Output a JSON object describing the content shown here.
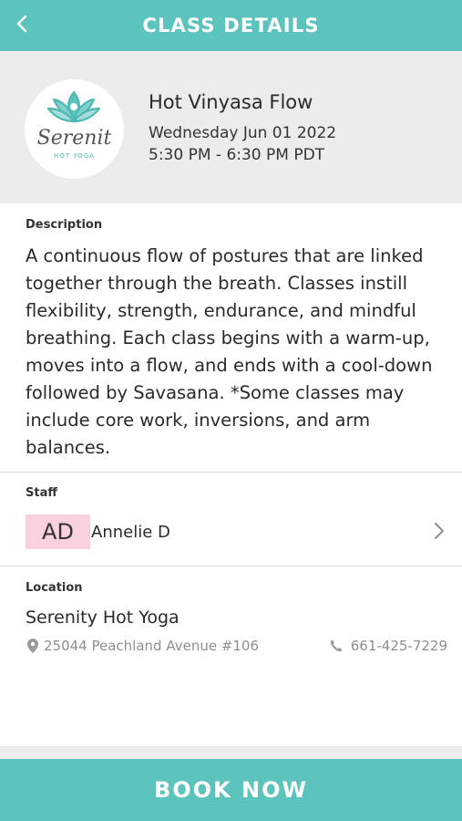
{
  "header": {
    "title": "CLASS DETAILS",
    "back_icon": "chevron-left-icon"
  },
  "class": {
    "logo": {
      "brand_text": "Serenit",
      "sub_text": "HOT YOGA",
      "icon": "lotus-icon"
    },
    "name": "Hot Vinyasa Flow",
    "date": "Wednesday Jun 01 2022",
    "time": "5:30 PM - 6:30 PM PDT"
  },
  "description": {
    "label": "Description",
    "text": "A continuous flow of postures that are linked together through the breath. Classes instill flexibility, strength, endurance, and mindful breathing. Each class begins with a warm-up, moves into a flow, and ends with a cool-down followed by Savasana. *Some classes may include core work, inversions, and arm balances."
  },
  "staff": {
    "label": "Staff",
    "initials": "AD",
    "name": "Annelie D",
    "chevron_icon": "chevron-right-icon"
  },
  "location": {
    "label": "Location",
    "name": "Serenity Hot Yoga",
    "address": "25044 Peachland Avenue #106",
    "address_icon": "map-pin-icon",
    "phone": "661-425-7229",
    "phone_icon": "phone-icon"
  },
  "actions": {
    "book_label": "BOOK NOW"
  },
  "colors": {
    "accent": "#5cc3bd",
    "avatar_bg": "#f8d0de",
    "card_bg": "#ececec"
  }
}
